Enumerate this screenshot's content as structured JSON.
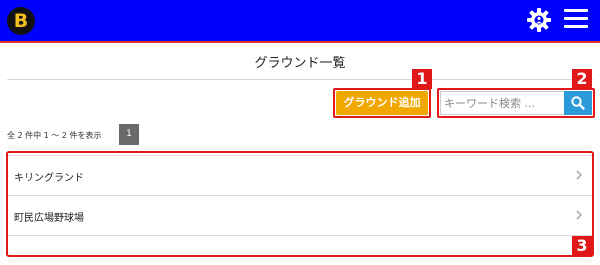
{
  "header": {
    "logo_text": "B",
    "background_color": "#0000ff",
    "accent_line_color": "#e03030",
    "icons": [
      "settings-gear-icon",
      "hamburger-menu-icon"
    ]
  },
  "page": {
    "title": "グラウンド一覧"
  },
  "toolbar": {
    "add_label": "グラウンド追加",
    "add_color": "#f0a800",
    "search_placeholder": "キーワード検索 ...",
    "search_button_color": "#2a9bd8"
  },
  "pagination": {
    "summary": "全 2 件中 1 ～ 2 件を表示",
    "current_page": "1"
  },
  "grounds": [
    {
      "name": "キリングランド"
    },
    {
      "name": "町民広場野球場"
    }
  ],
  "annotations": {
    "badge_1": "1",
    "badge_2": "2",
    "badge_3": "3",
    "highlight_color": "#e01818"
  }
}
